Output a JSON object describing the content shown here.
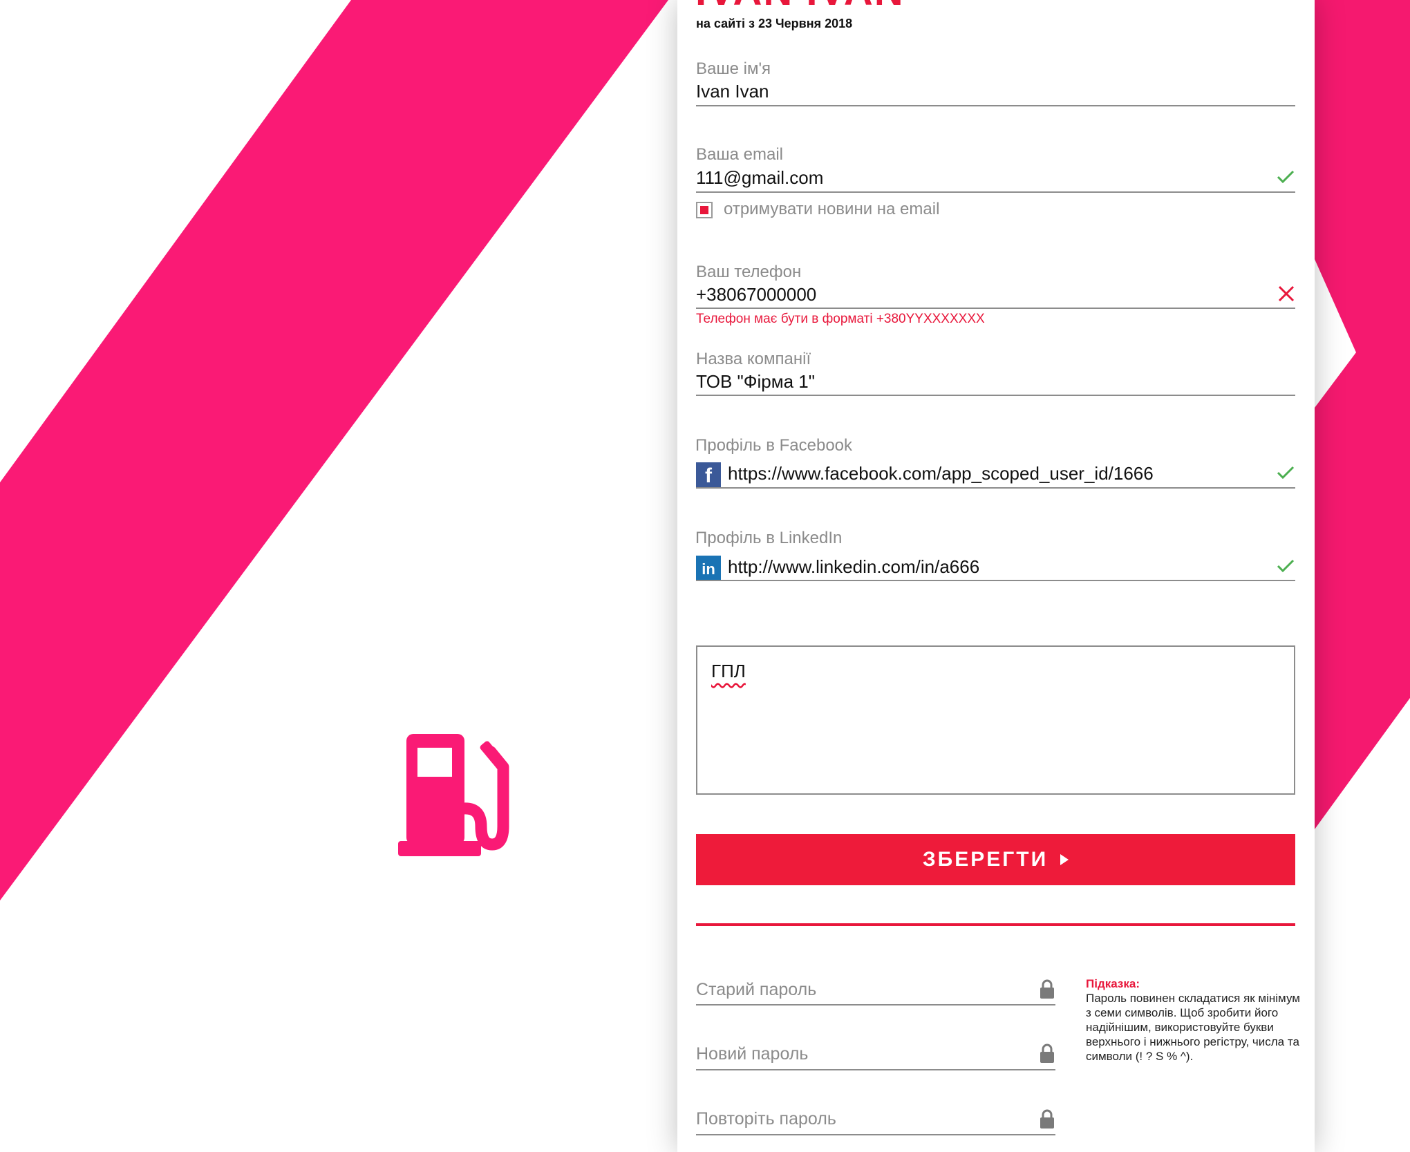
{
  "profile": {
    "name_heading": "IVAN IVAN",
    "member_since": "на сайті з 23 Червня 2018"
  },
  "form": {
    "name": {
      "label": "Ваше ім'я",
      "value": "Ivan Ivan"
    },
    "email": {
      "label": "Ваша email",
      "value": "111@gmail.com",
      "status": "valid"
    },
    "newsletter": {
      "label": "отримувати новини на email",
      "checked": true
    },
    "phone": {
      "label": "Ваш телефон",
      "value": "+38067000000",
      "status": "invalid",
      "error": "Телефон має бути в форматі +380YYXXXXXXX"
    },
    "company": {
      "label": "Назва компанії",
      "value": "ТОВ \"Фірма 1\""
    },
    "facebook": {
      "label": "Профіль в Facebook",
      "icon": "facebook-icon",
      "badge": "f",
      "value": "https://www.facebook.com/app_scoped_user_id/1666",
      "status": "valid"
    },
    "linkedin": {
      "label": "Профіль в LinkedIn",
      "icon": "linkedin-icon",
      "badge": "in",
      "value": "http://www.linkedin.com/in/a666",
      "status": "valid"
    },
    "notes": {
      "value": "ГПЛ"
    },
    "save_label": "ЗБЕРЕГТИ"
  },
  "password": {
    "old_label": "Старий пароль",
    "new_label": "Новий пароль",
    "repeat_label": "Повторіть пароль",
    "hint_title": "Підказка:",
    "hint_text": "Пароль повинен складатися як мінімум з семи символів. Щоб зробити його надійнішим, використовуйте букви верхнього і нижнього регістру, числа та символи (! ? S % ^)."
  },
  "colors": {
    "brand_pink": "#fa1a75",
    "accent_red": "#ee1b3a",
    "valid_green": "#4caf50",
    "facebook_blue": "#3b5998",
    "linkedin_blue": "#1a73b4"
  }
}
